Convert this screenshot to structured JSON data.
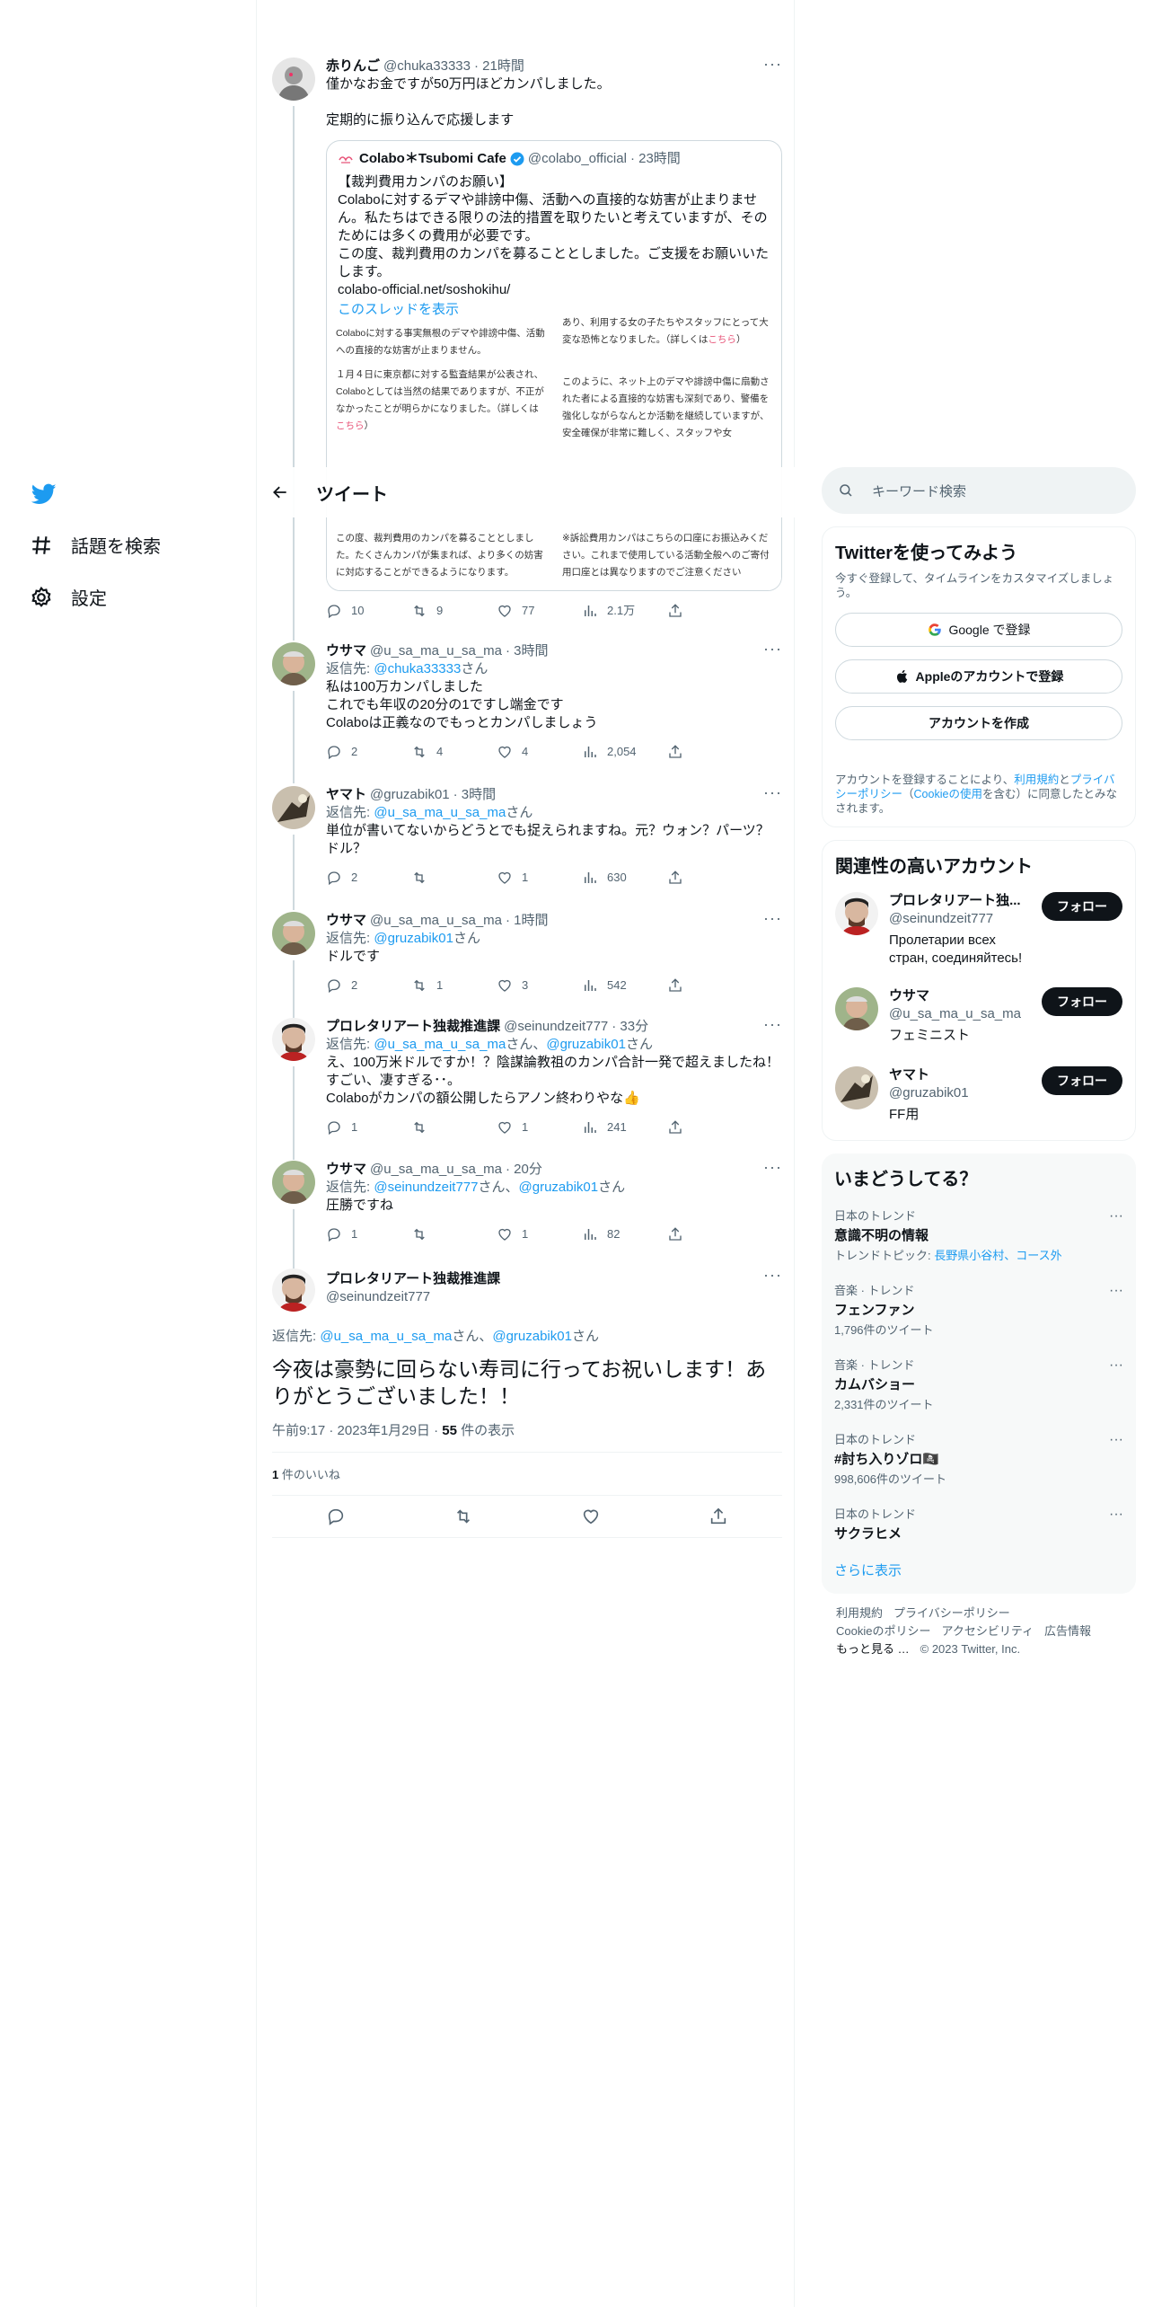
{
  "nav": {
    "explore": "話題を検索",
    "settings": "設定"
  },
  "header": {
    "title": "ツイート"
  },
  "tweets": [
    {
      "name": "赤りんご",
      "handle": "@chuka33333",
      "time": "· 21時間",
      "line1": "僅かなお金ですが50万円ほどカンパしました。",
      "line2": "定期的に振り込んで応援します",
      "replies": "10",
      "retweets": "9",
      "likes": "77",
      "views": "2.1万"
    },
    {
      "name": "ウサマ",
      "handle": "@u_sa_ma_u_sa_ma",
      "time": "· 3時間",
      "reply_prefix": "返信先: ",
      "reply_to": "@chuka33333",
      "reply_suffix": "さん",
      "line1": "私は100万カンパしました",
      "line2": "これでも年収の20分の1ですし端金です",
      "line3": "Colaboは正義なのでもっとカンパしましょう",
      "replies": "2",
      "retweets": "4",
      "likes": "4",
      "views": "2,054"
    },
    {
      "name": "ヤマト",
      "handle": "@gruzabik01",
      "time": "· 3時間",
      "reply_prefix": "返信先: ",
      "reply_to": "@u_sa_ma_u_sa_ma",
      "reply_suffix": "さん",
      "line1": "単位が書いてないからどうとでも捉えられますね。元？ウォン？パーツ？",
      "line2": "ドル？",
      "replies": "2",
      "retweets": "",
      "likes": "1",
      "views": "630"
    },
    {
      "name": "ウサマ",
      "handle": "@u_sa_ma_u_sa_ma",
      "time": "· 1時間",
      "reply_prefix": "返信先: ",
      "reply_to": "@gruzabik01",
      "reply_suffix": "さん",
      "line1": "ドルです",
      "replies": "2",
      "retweets": "1",
      "likes": "3",
      "views": "542"
    },
    {
      "name": "プロレタリアート独裁推進課",
      "handle": "@seinundzeit777",
      "time": "· 33分",
      "reply_prefix": "返信先: ",
      "reply_to": "@u_sa_ma_u_sa_ma",
      "reply_mid": "さん、",
      "reply_to2": "@gruzabik01",
      "reply_suffix": "さん",
      "line1": "え、100万米ドルですか！？陰謀論教祖のカンパ合計一発で超えましたね！",
      "line2": "すごい、凄すぎる･･。",
      "line3": "Colaboがカンパの額公開したらアノン終わりやな👍",
      "replies": "1",
      "retweets": "",
      "likes": "1",
      "views": "241"
    },
    {
      "name": "ウサマ",
      "handle": "@u_sa_ma_u_sa_ma",
      "time": "· 20分",
      "reply_prefix": "返信先: ",
      "reply_to": "@seinundzeit777",
      "reply_mid": "さん、",
      "reply_to2": "@gruzabik01",
      "reply_suffix": "さん",
      "line1": "圧勝ですね",
      "replies": "1",
      "retweets": "",
      "likes": "1",
      "views": "82"
    }
  ],
  "quote": {
    "name": "Colabo＊Tsubomi Cafe",
    "handle": "@colabo_official",
    "time": "· 23時間",
    "text1": "【裁判費用カンパのお願い】",
    "text2": "Colaboに対するデマや誹謗中傷、活動への直接的な妨害が止まりません。私たちはできる限りの法的措置を取りたいと考えていますが、そのためには多くの費用が必要です。",
    "text3": "この度、裁判費用のカンパを募ることとしました。ご支援をお願いいたします。",
    "link": "colabo-official.net/soshokihu/",
    "thread": "このスレッドを表示",
    "img_l1": "Colaboに対する事実無根のデマや誹謗中傷、活動への直接的な妨害が止まりません。",
    "img_l2": "１月４日に東京都に対する監査結果が公表され、Colaboとしては当然の結果でありますが、不正がなかったことが明らかになりました。（詳しくは",
    "img_l2_link": "こちら",
    "img_l2_end": "）",
    "img_l3": "この度、裁判費用のカンパを募ることとしました。たくさんカンパが集まれば、より多くの妨害に対応することができるようになります。",
    "img_r1": "あり、利用する女の子たちやスタッフにとって大変な恐怖となりました。（詳しくは",
    "img_r1_link": "こちら",
    "img_r1_end": "）",
    "img_r2": "このように、ネット上のデマや誹謗中傷に扇動された者による直接的な妨害も深刻であり、警備を強化しながらなんとか活動を継続していますが、安全確保が非常に難しく、スタッフや女",
    "img_r3": "※訴訟費用カンパはこちらの口座にお振込みください。これまで使用している活動全般へのご寄付用口座とは異なりますのでご注意ください"
  },
  "main_tweet": {
    "name": "プロレタリアート独裁推進課",
    "handle": "@seinundzeit777",
    "reply_prefix": "返信先: ",
    "reply_to": "@u_sa_ma_u_sa_ma",
    "reply_mid": "さん、",
    "reply_to2": "@gruzabik01",
    "reply_suffix": "さん",
    "text": "今夜は豪勢に回らない寿司に行ってお祝いします！ありがとうございました！！",
    "time": "午前9:17 · 2023年1月29日 · ",
    "views_count": "55",
    "views_label": " 件の表示",
    "likes_count": "1",
    "likes_label": " 件のいいね"
  },
  "right": {
    "search_placeholder": "キーワード検索",
    "signup": {
      "title": "Twitterを使ってみよう",
      "subtitle": "今すぐ登録して、タイムラインをカスタマイズしましょう。",
      "google": "Google で登録",
      "apple": "Appleのアカウントで登録",
      "create": "アカウントを作成",
      "legal1": "アカウントを登録することにより、",
      "terms": "利用規約",
      "and": "と",
      "privacy": "プライバシーポリシー",
      "legal2": "（",
      "cookie": "Cookieの使用",
      "legal3": "を含む）に同意したとみなされます。"
    },
    "recommend": {
      "title": "関連性の高いアカウント",
      "follow": "フォロー",
      "accounts": [
        {
          "name": "プロレタリアート独...",
          "handle": "@seinundzeit777",
          "bio": "Пролетарии всех стран, соединяйтесь!"
        },
        {
          "name": "ウサマ",
          "handle": "@u_sa_ma_u_sa_ma",
          "bio": "フェミニスト"
        },
        {
          "name": "ヤマト",
          "handle": "@gruzabik01",
          "bio": "FF用"
        }
      ]
    },
    "trends": {
      "title": "いまどうしてる？",
      "items": [
        {
          "cat": "日本のトレンド",
          "name": "意識不明の情報",
          "extra_prefix": "トレンドトピック: ",
          "extra_link": "長野県小谷村、コース外"
        },
        {
          "cat": "音楽 · トレンド",
          "name": "フェンファン",
          "extra": "1,796件のツイート"
        },
        {
          "cat": "音楽 · トレンド",
          "name": "カムバショー",
          "extra": "2,331件のツイート"
        },
        {
          "cat": "日本のトレンド",
          "name": "#討ち入りゾロ🏴‍☠️",
          "extra": "998,606件のツイート"
        },
        {
          "cat": "日本のトレンド",
          "name": "サクラヒメ",
          "extra": ""
        }
      ],
      "show_more": "さらに表示"
    },
    "footer": {
      "terms": "利用規約",
      "privacy": "プライバシーポリシー",
      "cookie": "Cookieのポリシー",
      "access": "アクセシビリティ",
      "ads": "広告情報",
      "more": "もっと見る …",
      "copyright": "© 2023 Twitter, Inc."
    }
  },
  "colors": {
    "accent": "#1d9bf0",
    "text": "#0f1419",
    "muted": "#536471"
  }
}
